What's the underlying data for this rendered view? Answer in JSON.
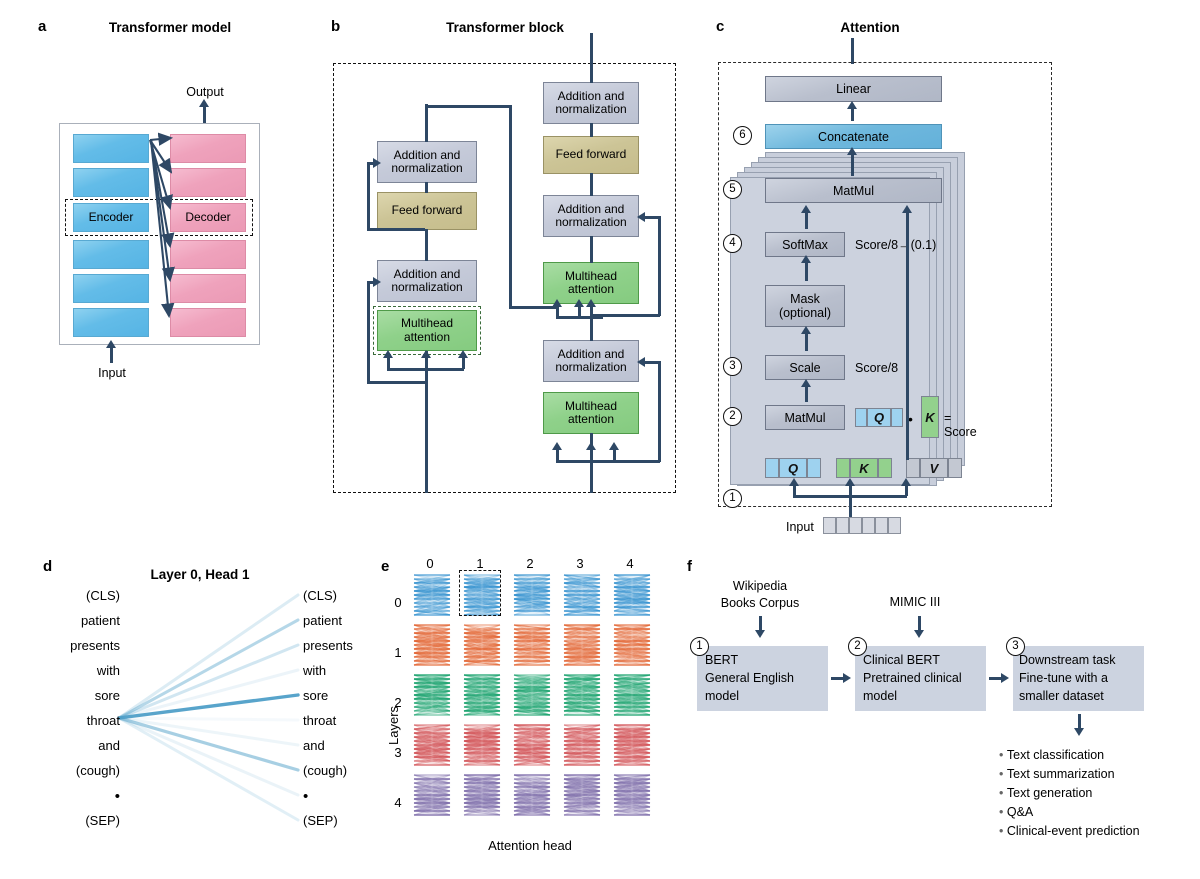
{
  "figure": {
    "panels": [
      {
        "letter": "a",
        "title": "Transformer model"
      },
      {
        "letter": "b",
        "title": "Transformer block"
      },
      {
        "letter": "c",
        "title": "Attention"
      },
      {
        "letter": "d",
        "title": "Layer 0, Head 1"
      },
      {
        "letter": "e",
        "title": ""
      },
      {
        "letter": "f",
        "title": ""
      }
    ]
  },
  "panel_a": {
    "letter": "a",
    "title": "Transformer model",
    "output_label": "Output",
    "input_label": "Input",
    "encoder_label": "Encoder",
    "decoder_label": "Decoder",
    "encoder_stack_count": 6,
    "decoder_stack_count": 6,
    "encoder_color": "#63bce8",
    "decoder_color": "#efa2bc",
    "highlighted_row_index": 2
  },
  "panel_b": {
    "letter": "b",
    "title": "Transformer block",
    "encoder_side": {
      "blocks": [
        {
          "label": "Addition and\nnormalization",
          "kind": "gray"
        },
        {
          "label": "Feed forward",
          "kind": "tan"
        },
        {
          "label": "Addition and\nnormalization",
          "kind": "gray"
        },
        {
          "label": "Multihead\nattention",
          "kind": "green",
          "highlighted": true
        }
      ]
    },
    "decoder_side": {
      "blocks": [
        {
          "label": "Addition and\nnormalization",
          "kind": "gray"
        },
        {
          "label": "Feed forward",
          "kind": "tan"
        },
        {
          "label": "Addition and\nnormalization",
          "kind": "gray"
        },
        {
          "label": "Multihead\nattention",
          "kind": "green"
        },
        {
          "label": "Addition and\nnormalization",
          "kind": "gray"
        },
        {
          "label": "Multihead\nattention",
          "kind": "green"
        }
      ]
    },
    "colors": {
      "gray": "#c5cad9",
      "tan": "#ccc496",
      "green": "#8fd18a",
      "arrow": "#2e4865"
    }
  },
  "panel_c": {
    "letter": "c",
    "title": "Attention",
    "steps": [
      {
        "number": "1",
        "label": ""
      },
      {
        "number": "2",
        "label": "MatMul"
      },
      {
        "number": "3",
        "label": "Scale"
      },
      {
        "number": "4",
        "label": "SoftMax"
      },
      {
        "number": "5",
        "label": "MatMul"
      },
      {
        "number": "6",
        "label": "Concatenate"
      }
    ],
    "linear_label": "Linear",
    "concatenate_label": "Concatenate",
    "matmul_top_label": "MatMul",
    "softmax_label": "SoftMax",
    "mask_label": "Mask\n(optional)",
    "scale_label": "Scale",
    "matmul_bottom_label": "MatMul",
    "annotation_softmax": "Score/8→(0.1)",
    "annotation_scale": "Score/8",
    "equation": {
      "q": "Q",
      "dot": "•",
      "k": "K",
      "equals": "= Score"
    },
    "qkv_labels": {
      "q": "Q",
      "k": "K",
      "v": "V"
    },
    "input_label": "Input",
    "input_cells": 6,
    "stack_count": 6,
    "colors": {
      "q": "#9ed2ef",
      "k": "#93d18d",
      "v": "#c3c8d2",
      "concat": "#6fb8dd",
      "card": "#ccd2de"
    }
  },
  "panel_d": {
    "letter": "d",
    "title": "Layer 0, Head 1",
    "tokens_left": [
      "(CLS)",
      "patient",
      "presents",
      "with",
      "sore",
      "throat",
      "and",
      "(cough)",
      "•",
      "(SEP)"
    ],
    "tokens_right": [
      "(CLS)",
      "patient",
      "presents",
      "with",
      "sore",
      "throat",
      "and",
      "(cough)",
      "•",
      "(SEP)"
    ],
    "source_token_index": 5,
    "source_token": "throat",
    "attention_weights": [
      0.2,
      0.42,
      0.26,
      0.11,
      0.95,
      0.06,
      0.1,
      0.5,
      0.12,
      0.17
    ],
    "line_color": "#4f9fc8"
  },
  "panel_e": {
    "letter": "e",
    "column_label": "Attention head",
    "row_label": "Layers",
    "column_ticks": [
      "0",
      "1",
      "2",
      "3",
      "4"
    ],
    "row_ticks": [
      "0",
      "1",
      "2",
      "3",
      "4"
    ],
    "highlighted_cell": {
      "layer": 0,
      "head": 1
    },
    "row_colors": [
      "#2f8fce",
      "#e2622f",
      "#14a06a",
      "#d14f53",
      "#7b6aa8"
    ]
  },
  "panel_f": {
    "letter": "f",
    "inputs": [
      {
        "label": "Wikipedia\nBooks Corpus",
        "target_step": 1
      },
      {
        "label": "MIMIC III",
        "target_step": 2
      }
    ],
    "stages": [
      {
        "number": "1",
        "label": "BERT\nGeneral English\nmodel"
      },
      {
        "number": "2",
        "label": "Clinical BERT\nPretrained clinical\nmodel"
      },
      {
        "number": "3",
        "label": "Downstream task\nFine-tune with a\nsmaller dataset"
      }
    ],
    "outputs": [
      "Text classification",
      "Text summarization",
      "Text generation",
      "Q&A",
      "Clinical-event prediction"
    ],
    "box_color": "#ccd3e0"
  }
}
